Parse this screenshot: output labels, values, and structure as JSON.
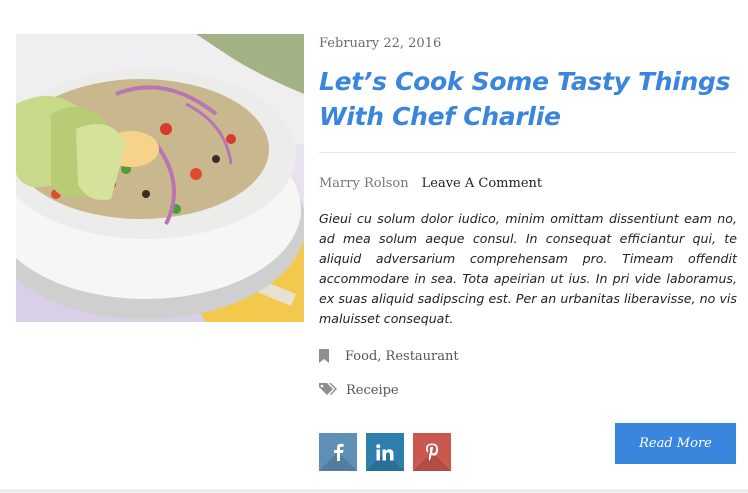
{
  "post": {
    "date": "February 22, 2016",
    "title": "Let’s Cook Some Tasty Things With Chef Charlie",
    "author": "Marry Rolson",
    "comment_link": "Leave A Comment",
    "excerpt": "Gieui cu solum dolor iudico, minim omittam dissentiunt eam no, ad mea solum aeque consul. In consequat efficiantur qui, te aliquid adversarium comprehensam pro. Timeam offendit accommodare in sea. Tota apeirian ut ius. In pri vide laboramus, ex suas aliquid sadipscing est. Per an urbanitas liberavisse, no vis maluisset consequat.",
    "categories": "Food, Restaurant",
    "tags": "Receipe",
    "read_more": "Read More"
  },
  "icons": {
    "category": "bookmark-icon",
    "tags": "tags-icon",
    "social": [
      "facebook-icon",
      "linkedin-icon",
      "pinterest-icon"
    ]
  },
  "colors": {
    "accent": "#3a86de",
    "facebook": "#5f8fb4",
    "linkedin": "#2f7fad",
    "pinterest": "#c9584f"
  }
}
